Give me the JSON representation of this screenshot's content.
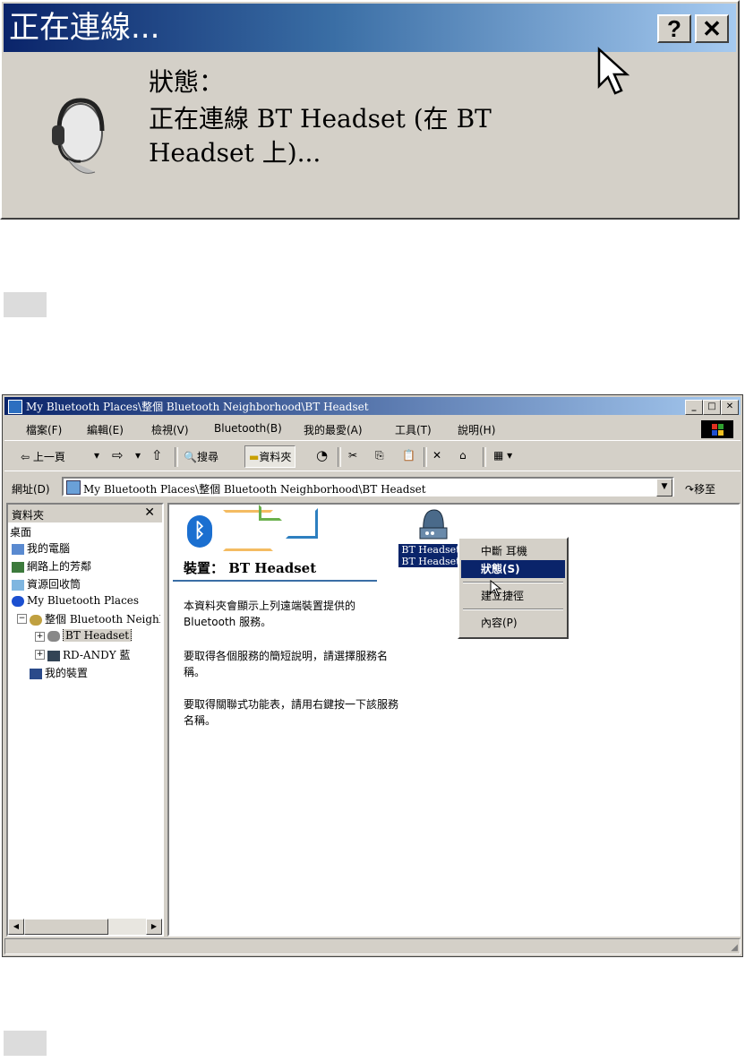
{
  "dialog": {
    "title": "正在連線...",
    "help_button": "?",
    "close_button": "✕",
    "status_label": "狀態：",
    "message": "正在連線 BT Headset (在 BT Headset 上)..."
  },
  "explorer": {
    "title": "My Bluetooth Places\\整個 Bluetooth Neighborhood\\BT Headset",
    "window_buttons": {
      "minimize": "_",
      "maximize": "□",
      "close": "✕"
    },
    "menu": [
      "檔案(F)",
      "編輯(E)",
      "檢視(V)",
      "Bluetooth(B)",
      "我的最愛(A)",
      "工具(T)",
      "說明(H)"
    ],
    "toolbar": {
      "back": "⇦ 上一頁",
      "back_arrow": "▾",
      "forward": "⇨",
      "forward_arrow": "▾",
      "up": "⇧",
      "search": "搜尋",
      "folders": "資料夾",
      "history": "◔",
      "cut": "✂",
      "copy": "⎘",
      "paste": "📋",
      "delete": "✕",
      "properties": "⌂",
      "views": "▦ ▾"
    },
    "address": {
      "label": "網址(D)",
      "value": "My Bluetooth Places\\整個 Bluetooth Neighborhood\\BT Headset",
      "dropdown": "▼",
      "go": "移至"
    },
    "folders_pane": {
      "title": "資料夾",
      "close": "✕",
      "items": [
        "桌面",
        "我的電腦",
        "網路上的芳鄰",
        "資源回收筒",
        "My Bluetooth Places",
        "整個 Bluetooth Neighborhood",
        "BT Headset",
        "RD-ANDY 藍",
        "我的裝置"
      ],
      "scroll_left": "◀",
      "scroll_right": "▶"
    },
    "content": {
      "heading": "裝置： BT Headset",
      "bt_symbol": "ᛒ",
      "para1": "本資料夾會顯示上列遠端裝置提供的 Bluetooth 服務。",
      "para2": "要取得各個服務的簡短說明，請選擇服務名稱。",
      "para3": "要取得關聯式功能表，請用右鍵按一下該服務名稱。",
      "device_label_1": "BT Headset",
      "device_label_2": "BT Headset"
    },
    "context_menu": {
      "items": [
        "中斷 耳機",
        "狀態(S)",
        "建立捷徑",
        "內容(P)"
      ],
      "selected": "狀態(S)"
    }
  }
}
